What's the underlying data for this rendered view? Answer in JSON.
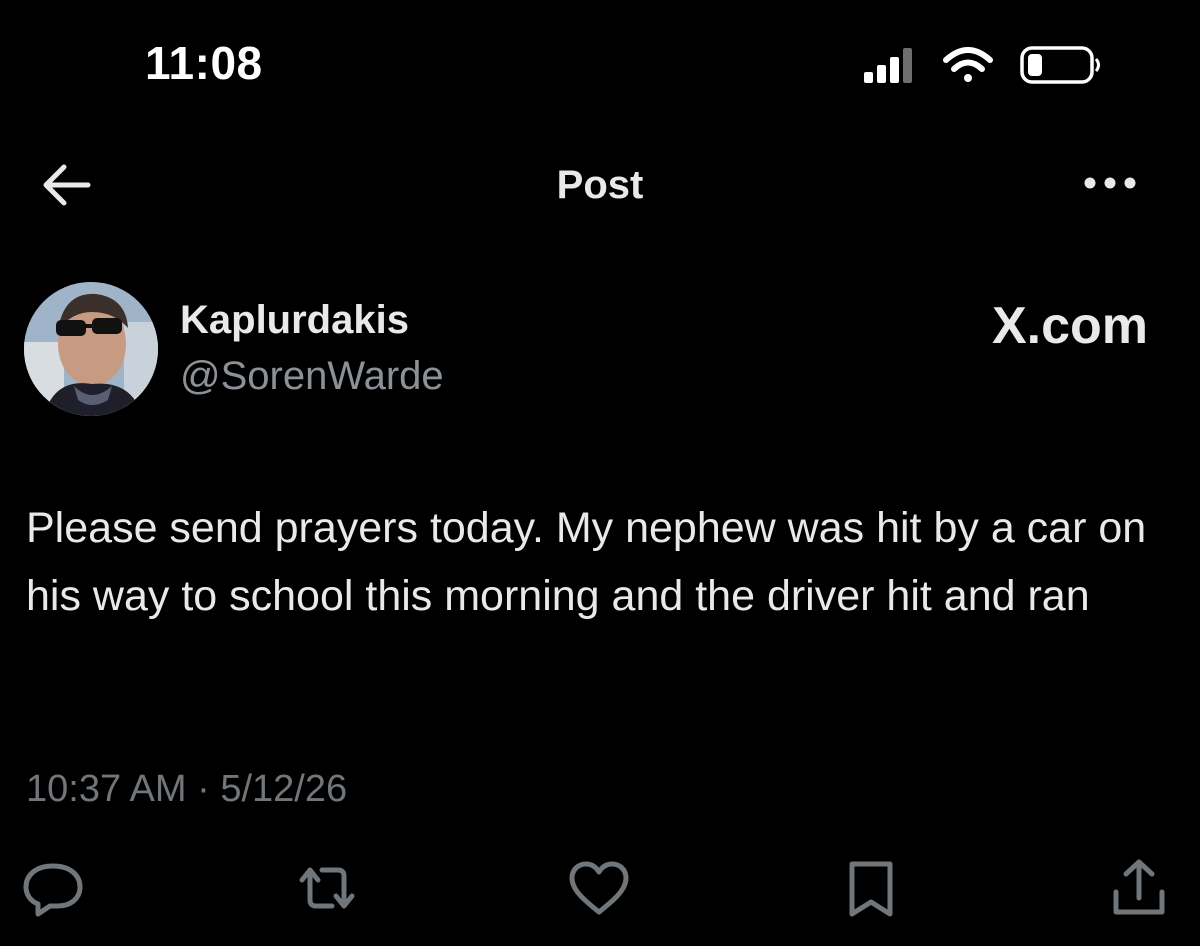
{
  "status_bar": {
    "time": "11:08",
    "icons": [
      "cellular-signal-icon",
      "wifi-icon",
      "battery-icon"
    ]
  },
  "header": {
    "title": "Post",
    "back_icon": "arrow-left-icon",
    "more_icon": "more-horizontal-icon"
  },
  "author": {
    "display_name": "Kaplurdakis",
    "handle": "@SorenWarde",
    "watermark": "X.com"
  },
  "post": {
    "text": "Please send prayers today. My nephew was hit by a car on his way to school this morning and the driver hit and ran",
    "time": "10:37 AM",
    "separator": " · ",
    "date": "5/12/26"
  },
  "actions": {
    "icons": [
      "reply-icon",
      "repost-icon",
      "like-icon",
      "bookmark-icon",
      "share-icon"
    ]
  },
  "colors": {
    "background": "#000000",
    "primary_text": "#e7e9ea",
    "secondary_text": "#71767b"
  }
}
